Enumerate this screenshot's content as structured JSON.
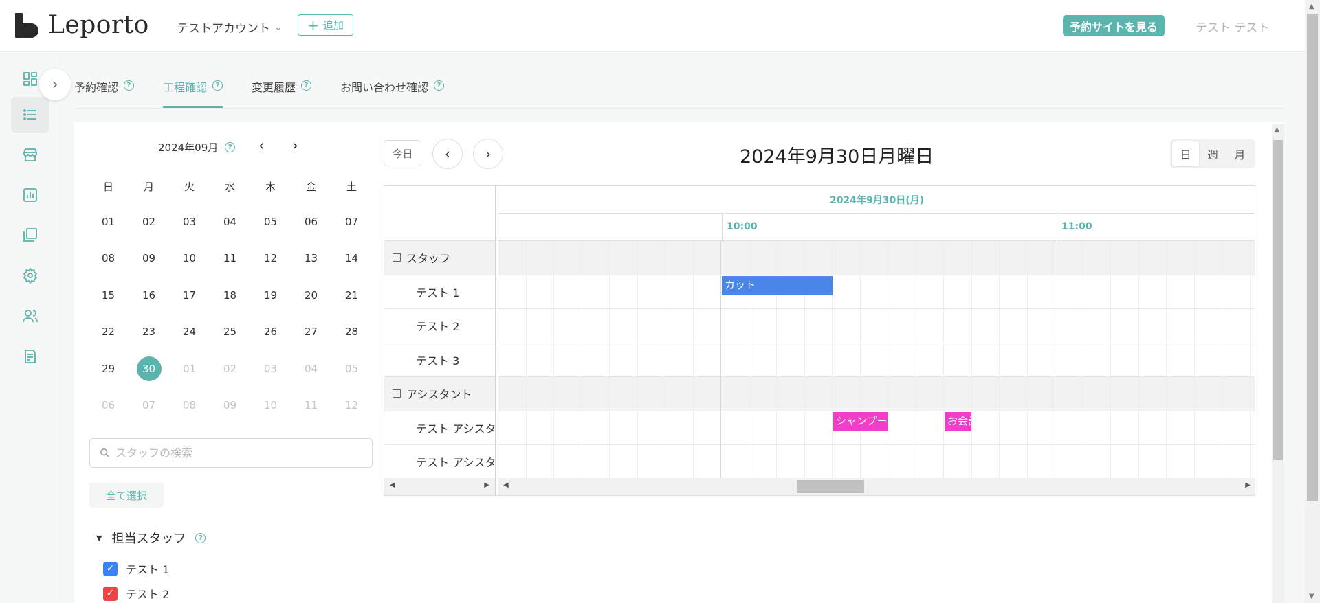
{
  "header": {
    "logo_text": "Leporto",
    "account_name": "テストアカウント",
    "add_label": "追加",
    "booking_site_label": "予約サイトを見る",
    "user_name": "テスト テスト"
  },
  "tabs": [
    {
      "label": "予約確認",
      "active": false
    },
    {
      "label": "工程確認",
      "active": true
    },
    {
      "label": "変更履歴",
      "active": false
    },
    {
      "label": "お問い合わせ確認",
      "active": false
    }
  ],
  "sidebar": {
    "items": [
      "dashboard-icon",
      "list-icon",
      "store-icon",
      "report-icon",
      "gallery-icon",
      "gear-icon",
      "users-icon",
      "document-icon"
    ],
    "active_index": 1
  },
  "mini_calendar": {
    "month_label": "2024年09月",
    "weekdays": [
      "日",
      "月",
      "火",
      "水",
      "木",
      "金",
      "土"
    ],
    "weeks": [
      [
        "01",
        "02",
        "03",
        "04",
        "05",
        "06",
        "07"
      ],
      [
        "08",
        "09",
        "10",
        "11",
        "12",
        "13",
        "14"
      ],
      [
        "15",
        "16",
        "17",
        "18",
        "19",
        "20",
        "21"
      ],
      [
        "22",
        "23",
        "24",
        "25",
        "26",
        "27",
        "28"
      ],
      [
        "29",
        "30",
        "01",
        "02",
        "03",
        "04",
        "05"
      ],
      [
        "06",
        "07",
        "08",
        "09",
        "10",
        "11",
        "12"
      ]
    ],
    "selected": "30"
  },
  "search": {
    "placeholder": "スタッフの検索",
    "value": ""
  },
  "select_all_label": "全て選択",
  "staff_filter": {
    "title": "担当スタッフ",
    "items": [
      {
        "label": "テスト 1",
        "checked": true,
        "color": "#3b82f6"
      },
      {
        "label": "テスト 2",
        "checked": true,
        "color": "#ef4444"
      }
    ]
  },
  "scheduler": {
    "today_label": "今日",
    "title": "2024年9月30日月曜日",
    "views": [
      {
        "label": "日",
        "active": true
      },
      {
        "label": "週",
        "active": false
      },
      {
        "label": "月",
        "active": false
      }
    ],
    "date_header": "2024年9月30日(月)",
    "hours": [
      "10:00",
      "11:00"
    ],
    "resources": [
      {
        "type": "group",
        "label": "スタッフ",
        "toggle": "−"
      },
      {
        "type": "member",
        "label": "テスト 1"
      },
      {
        "type": "member",
        "label": "テスト 2"
      },
      {
        "type": "member",
        "label": "テスト 3"
      },
      {
        "type": "group",
        "label": "アシスタント",
        "toggle": "−"
      },
      {
        "type": "member",
        "label": "テスト アシスタント"
      },
      {
        "type": "member",
        "label": "テスト アシスタント"
      }
    ],
    "events": [
      {
        "label": "カット",
        "row": 1,
        "color": "#4a86e8"
      },
      {
        "label": "シャンプー",
        "row": 5,
        "color": "#f03ec8"
      },
      {
        "label": "お会計",
        "row": 5,
        "color": "#f03ec8"
      }
    ]
  }
}
